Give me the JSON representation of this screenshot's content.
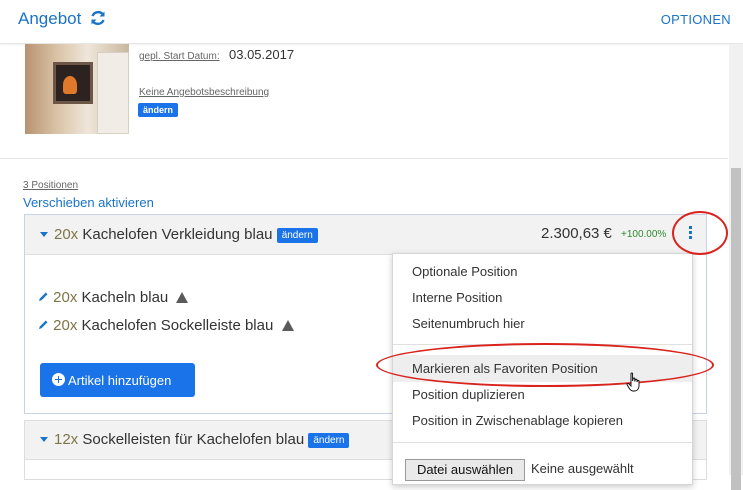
{
  "header": {
    "title": "Angebot",
    "options_label": "OPTIONEN"
  },
  "offer": {
    "start_date_label": "gepl. Start Datum:",
    "start_date_value": "03.05.2017",
    "no_description": "Keine Angebotsbeschreibung",
    "edit_label": "ändern"
  },
  "positions": {
    "count_label": "3 Positionen",
    "reorder_label": "Verschieben aktivieren",
    "items": [
      {
        "qty": "20x",
        "title": "Kachelofen Verkleidung blau",
        "edit_label": "ändern",
        "price": "2.300,63 €",
        "percent": "+100.00%",
        "sub_items": [
          {
            "qty": "20x",
            "name": "Kacheln blau"
          },
          {
            "qty": "20x",
            "name": "Kachelofen Sockelleiste blau"
          }
        ],
        "add_button": "Artikel hinzufügen"
      },
      {
        "qty": "12x",
        "title": "Sockelleisten für Kachelofen blau",
        "edit_label": "ändern"
      }
    ]
  },
  "context_menu": {
    "items": [
      "Optionale Position",
      "Interne Position",
      "Seitenumbruch hier",
      "Markieren als Favoriten Position",
      "Position duplizieren",
      "Position in Zwischenablage kopieren"
    ],
    "file_button": "Datei auswählen",
    "file_none": "Keine ausgewählt"
  },
  "colors": {
    "accent": "#1a73c7",
    "button": "#1a73e8",
    "annotation": "#d9231d",
    "percent": "#2f8a2f"
  },
  "icons": [
    "refresh-icon",
    "pencil-icon",
    "warning-icon",
    "plus-circle-icon",
    "kebab-menu-icon",
    "caret-down-icon",
    "hand-cursor-icon"
  ]
}
